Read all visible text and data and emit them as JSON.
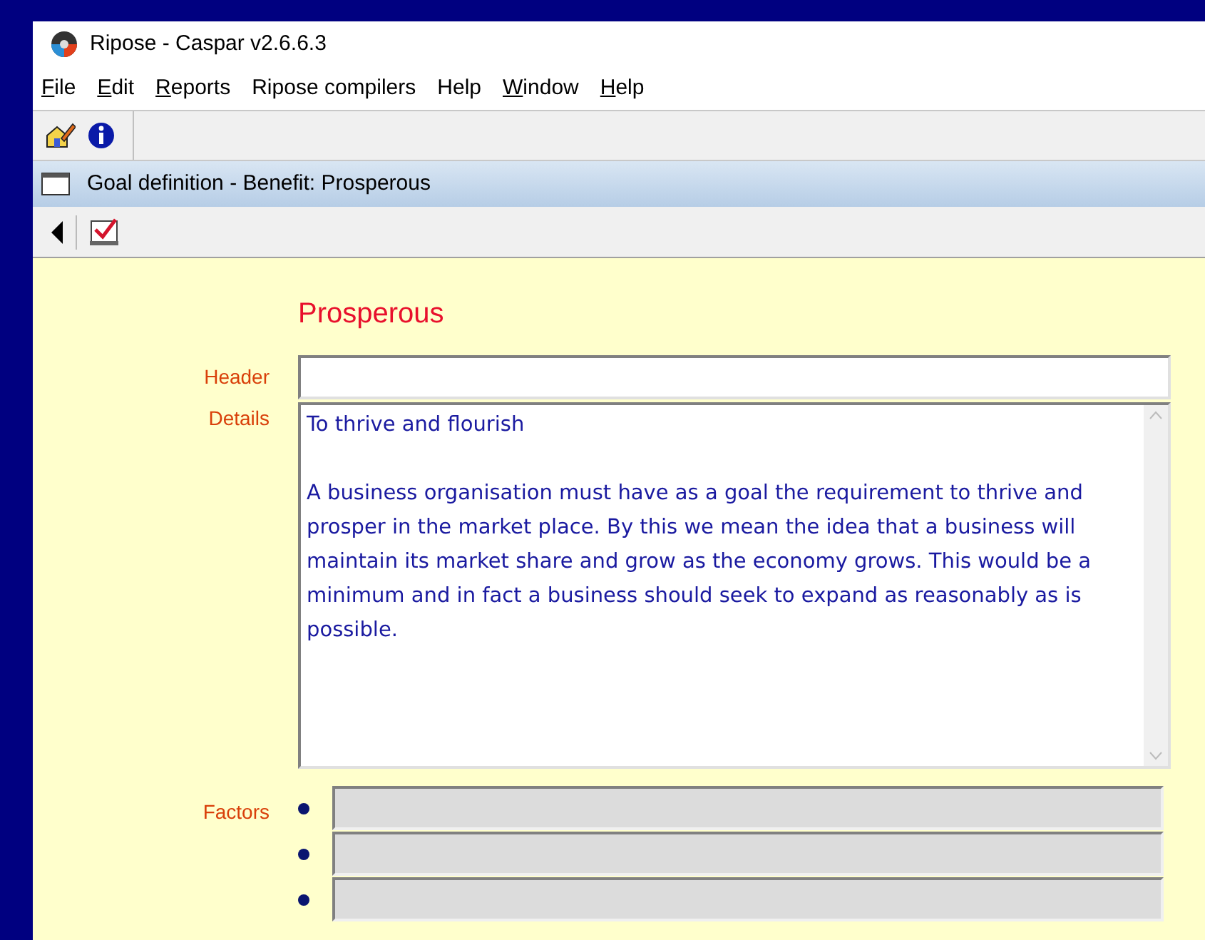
{
  "window": {
    "title": "Ripose - Caspar v2.6.6.3"
  },
  "menu": [
    {
      "label": "File",
      "mnemonic": true
    },
    {
      "label": "Edit",
      "mnemonic": true
    },
    {
      "label": "Reports",
      "mnemonic": true
    },
    {
      "label": "Ripose compilers",
      "mnemonic": false
    },
    {
      "label": "Help",
      "mnemonic": false
    },
    {
      "label": "Window",
      "mnemonic": true
    },
    {
      "label": "Help",
      "mnemonic": true
    }
  ],
  "child_window": {
    "title": "Goal definition - Benefit: Prosperous"
  },
  "form": {
    "heading": "Prosperous",
    "header": {
      "label": "Header"
    },
    "details": {
      "label": "Details",
      "paragraphs": [
        "To thrive and flourish",
        "A business organisation must have as a goal the requirement  to thrive and prosper in the market place. By this we mean the idea that a business will maintain its market share and grow as the economy grows. This would  be a minimum and in fact a business should seek to expand as reasonably as is possible."
      ]
    },
    "factors": {
      "label": "Factors",
      "fields": [
        {
          "disabled": true
        },
        {
          "disabled": true
        },
        {
          "disabled": true
        }
      ]
    }
  }
}
